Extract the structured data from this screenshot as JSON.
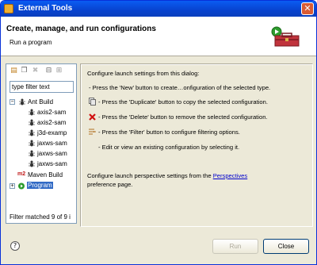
{
  "window": {
    "title": "External Tools",
    "close_glyph": "✕"
  },
  "header": {
    "heading": "Create, manage, and run configurations",
    "subtitle": "Run a program"
  },
  "toolbar": {
    "icons": [
      "new-config-icon",
      "duplicate-icon",
      "delete-icon",
      "collapse-icon",
      "filter-icon"
    ]
  },
  "filter": {
    "placeholder": "type filter text"
  },
  "tree": {
    "ant_build": "Ant Build",
    "children": [
      "axis2-sam",
      "axis2-sam",
      "j3d-examp",
      "jaxws-sam",
      "jaxws-sam",
      "jaxws-sam"
    ],
    "maven_prefix": "m2",
    "maven_build": "Maven Build",
    "program": "Program"
  },
  "status": "Filter matched 9 of 9 i",
  "right": {
    "intro": "Configure launch settings from this dialog:",
    "new_line": "- Press the 'New' button to create…onfiguration of the selected type.",
    "duplicate_line": "- Press the 'Duplicate' button to copy the selected configuration.",
    "delete_line": "- Press the 'Delete' button to remove the selected configuration.",
    "filter_line": "- Press the 'Filter' button to configure filtering options.",
    "edit_line": "- Edit or view an existing configuration by selecting it.",
    "perspective_pre": "Configure launch perspective settings from the ",
    "perspective_link": "Perspectives",
    "perspective_post": "preference page."
  },
  "footer": {
    "help": "?",
    "run": "Run",
    "close": "Close"
  }
}
